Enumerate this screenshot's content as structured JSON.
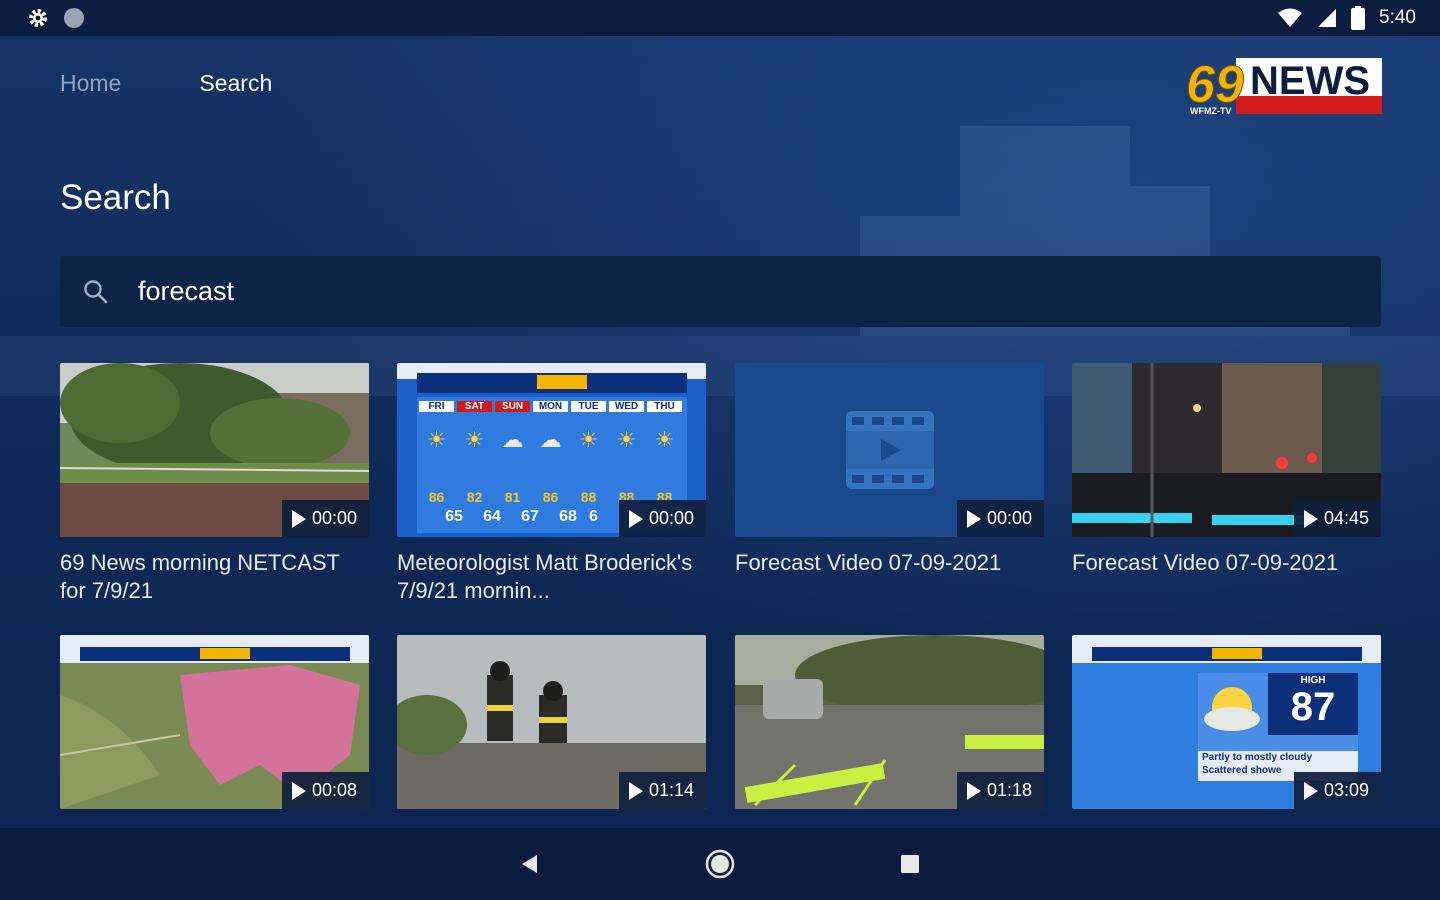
{
  "status_bar": {
    "time": "5:40",
    "icons": [
      "gear-icon",
      "circle-notification-icon",
      "wifi-icon",
      "signal-icon",
      "battery-icon"
    ]
  },
  "nav": {
    "tabs": [
      {
        "label": "Home",
        "active": false
      },
      {
        "label": "Search",
        "active": true
      }
    ]
  },
  "logo": {
    "number": "69",
    "word": "NEWS",
    "callsign": "WFMZ-TV"
  },
  "page_title": "Search",
  "search": {
    "value": "forecast",
    "icon": "search-icon"
  },
  "results": [
    {
      "title": "69 News morning NETCAST for 7/9/21",
      "duration": "00:00",
      "thumb": "fallen-tree"
    },
    {
      "title": "Meteorologist Matt Broderick's 7/9/21 mornin...",
      "duration": "00:00",
      "thumb": "weather-forecast",
      "forecast": {
        "days": [
          "FRI",
          "SAT",
          "SUN",
          "MON",
          "TUE",
          "WED",
          "THU"
        ],
        "highs": [
          "86",
          "82",
          "81",
          "86",
          "88",
          "88",
          "88"
        ],
        "lows": [
          "65",
          "64",
          "67",
          "68",
          "6"
        ]
      }
    },
    {
      "title": "Forecast Video 07-09-2021",
      "duration": "00:00",
      "thumb": "video-placeholder"
    },
    {
      "title": "Forecast Video 07-09-2021",
      "duration": "04:45",
      "thumb": "city-night"
    },
    {
      "title": "",
      "duration": "00:08",
      "thumb": "weather-map"
    },
    {
      "title": "",
      "duration": "01:14",
      "thumb": "firefighters"
    },
    {
      "title": "",
      "duration": "01:18",
      "thumb": "road-closed"
    },
    {
      "title": "",
      "duration": "03:09",
      "thumb": "high-temp",
      "high": {
        "label": "HIGH",
        "value": "87",
        "caption1": "Partly to mostly cloudy",
        "caption2": "Scattered showers"
      }
    }
  ],
  "colors": {
    "background": "#0f2a58",
    "bars": "#0b1d3e",
    "search_box": "#0e2446",
    "logo_red": "#d21a1a",
    "logo_gold": "#f4b400"
  },
  "system_nav": {
    "icons": [
      "back-icon",
      "home-icon",
      "recents-icon"
    ]
  }
}
